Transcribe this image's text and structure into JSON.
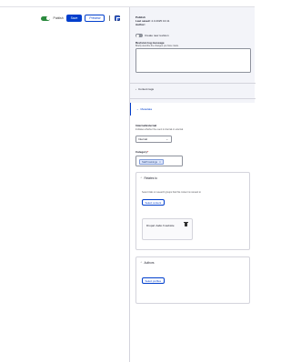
{
  "toolbar": {
    "publish_label": "Publish",
    "save_label": "Save",
    "preview_label": "Preview"
  },
  "sidebar": {
    "status_label": "Publish",
    "last_saved_label": "Last saved:",
    "last_saved_value": "4.3.2025 13:41",
    "author_label": "Author:",
    "create_revision_label": "Create new revision",
    "revision_log_title": "Revision log message",
    "revision_log_desc": "Briefly describe the changes you have made.",
    "content_tags_label": "Content tags",
    "metadata_label": "Metadata",
    "internal_title": "Internal/external",
    "internal_desc": "Indicates whether the event is internal or external.",
    "internal_value": "Internal",
    "category_title": "Category",
    "category_required": "*",
    "category_tag": "Staff trainings",
    "category_tag_remove": "×",
    "relates_to": {
      "title": "Relates to",
      "desc": "Select trials or research groups that this content is relevant to",
      "select_button": "Select content",
      "entity_text": "Drupal: Aalto.fi website"
    },
    "authors": {
      "title": "Authors",
      "select_button": "Select profiles"
    }
  },
  "icons": {
    "chevron_right": "›",
    "chevron_down": "⌄",
    "chevron_up": "⌃",
    "caret_down": "⌄"
  },
  "colors": {
    "accent": "#003ecc",
    "toggle_on": "#2b8a3e",
    "panel_bg": "#f3f4f9"
  }
}
